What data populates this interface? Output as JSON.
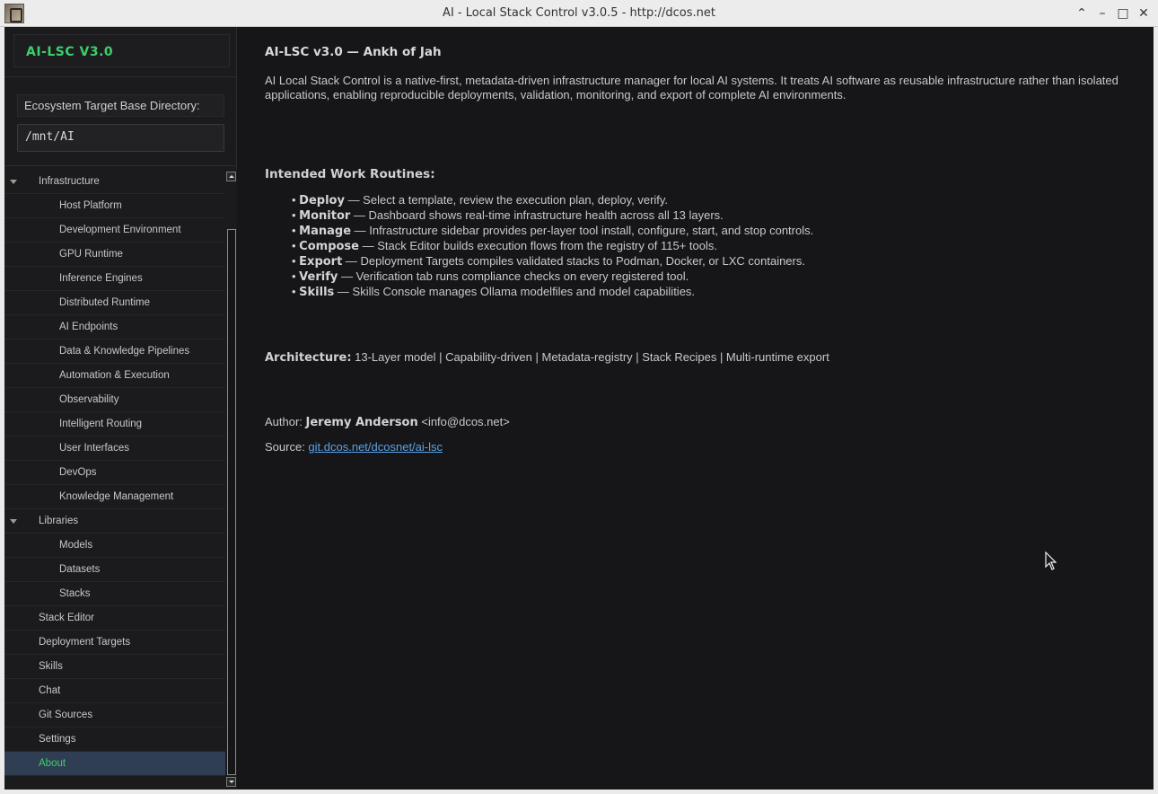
{
  "window": {
    "title": "AI - Local Stack Control v3.0.5 - http://dcos.net",
    "controls": [
      "chevron-up",
      "minimize",
      "maximize",
      "close"
    ]
  },
  "sidebar": {
    "brand": "AI-LSC V3.0",
    "dir_label": "Ecosystem Target Base Directory:",
    "dir_value": "/mnt/AI",
    "tree": [
      {
        "label": "Infrastructure",
        "level": 0,
        "expanded": true
      },
      {
        "label": "Host Platform",
        "level": 1
      },
      {
        "label": "Development Environment",
        "level": 1
      },
      {
        "label": "GPU Runtime",
        "level": 1
      },
      {
        "label": "Inference Engines",
        "level": 1
      },
      {
        "label": "Distributed Runtime",
        "level": 1
      },
      {
        "label": "AI Endpoints",
        "level": 1
      },
      {
        "label": "Data & Knowledge Pipelines",
        "level": 1
      },
      {
        "label": "Automation & Execution",
        "level": 1
      },
      {
        "label": "Observability",
        "level": 1
      },
      {
        "label": "Intelligent Routing",
        "level": 1
      },
      {
        "label": "User Interfaces",
        "level": 1
      },
      {
        "label": "DevOps",
        "level": 1
      },
      {
        "label": "Knowledge Management",
        "level": 1
      },
      {
        "label": "Libraries",
        "level": 0,
        "expanded": true
      },
      {
        "label": "Models",
        "level": 1
      },
      {
        "label": "Datasets",
        "level": 1
      },
      {
        "label": "Stacks",
        "level": 1
      },
      {
        "label": "Stack Editor",
        "level": 0
      },
      {
        "label": "Deployment Targets",
        "level": 0
      },
      {
        "label": "Skills",
        "level": 0
      },
      {
        "label": "Chat",
        "level": 0
      },
      {
        "label": "Git Sources",
        "level": 0
      },
      {
        "label": "Settings",
        "level": 0
      },
      {
        "label": "About",
        "level": 0,
        "active": true
      }
    ]
  },
  "main": {
    "heading": "AI-LSC v3.0 — Ankh of Jah",
    "description": "AI Local Stack Control is a native-first, metadata-driven infrastructure manager for local AI systems. It treats AI software as reusable infrastructure rather than isolated applications, enabling reproducible deployments, validation, monitoring, and export of complete AI environments.",
    "routines_heading": "Intended Work Routines:",
    "routines": [
      {
        "name": "Deploy",
        "text": " — Select a template, review the execution plan, deploy, verify."
      },
      {
        "name": "Monitor",
        "text": " — Dashboard shows real-time infrastructure health across all 13 layers."
      },
      {
        "name": "Manage",
        "text": " — Infrastructure sidebar provides per-layer tool install, configure, start, and stop controls."
      },
      {
        "name": "Compose",
        "text": " — Stack Editor builds execution flows from the registry of 115+ tools."
      },
      {
        "name": "Export",
        "text": " — Deployment Targets compiles validated stacks to Podman, Docker, or LXC containers."
      },
      {
        "name": "Verify",
        "text": " — Verification tab runs compliance checks on every registered tool."
      },
      {
        "name": "Skills",
        "text": " — Skills Console manages Ollama modelfiles and model capabilities."
      }
    ],
    "architecture_label": "Architecture:",
    "architecture_text": " 13-Layer model | Capability-driven | Metadata-registry | Stack Recipes | Multi-runtime export",
    "author_label": "Author: ",
    "author_name": "Jeremy Anderson",
    "author_email": " <info@dcos.net>",
    "source_label": "Source: ",
    "source_link": "git.dcos.net/dcosnet/ai-lsc"
  },
  "colors": {
    "brand_green": "#3ccf6a",
    "background": "#161618",
    "active_row": "#2f3e52",
    "link": "#5aa2e6"
  }
}
